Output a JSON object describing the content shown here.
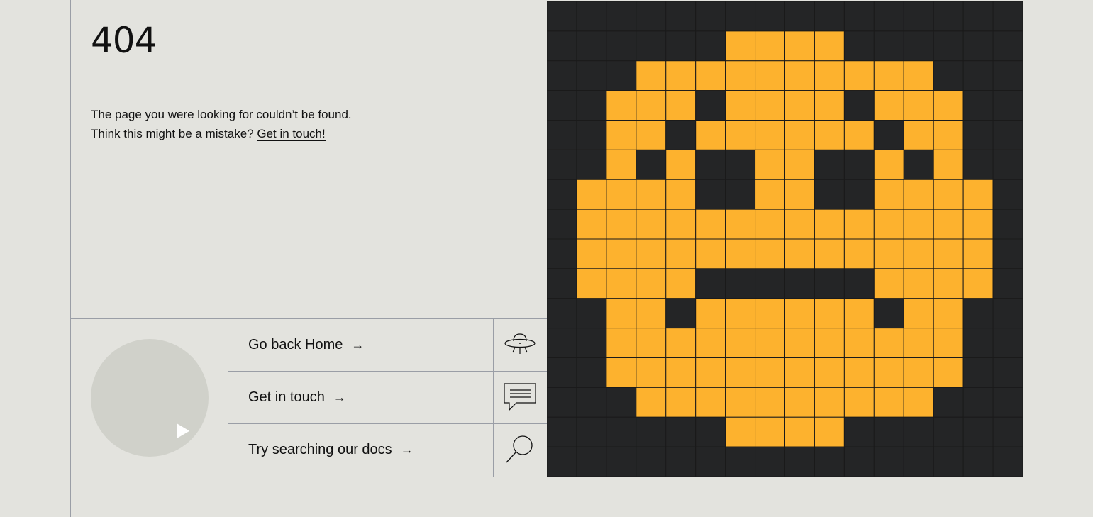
{
  "error": {
    "code": "404",
    "message_line1": "The page you were looking for couldn’t be found.",
    "message_line2": "Think this might be a mistake?",
    "contact_link": "Get in touch!"
  },
  "links": [
    {
      "label": "Go back Home",
      "arrow": "→",
      "icon": "ufo-icon"
    },
    {
      "label": "Get in touch",
      "arrow": "→",
      "icon": "chat-bubble-icon"
    },
    {
      "label": "Try searching our docs",
      "arrow": "→",
      "icon": "search-icon"
    }
  ],
  "pixel_art": {
    "colors": {
      "background": "#242526",
      "face": "#fdb22e"
    },
    "rows": [
      "................",
      "......####......",
      "...##########...",
      "..###.####.###..",
      "..##.######.##..",
      "..#.#..##..#.#..",
      ".####..##..####.",
      ".##############.",
      ".##############.",
      ".####......####.",
      "..##.######.##..",
      "..############..",
      "..############..",
      "...##########...",
      "......####......",
      "................"
    ]
  }
}
